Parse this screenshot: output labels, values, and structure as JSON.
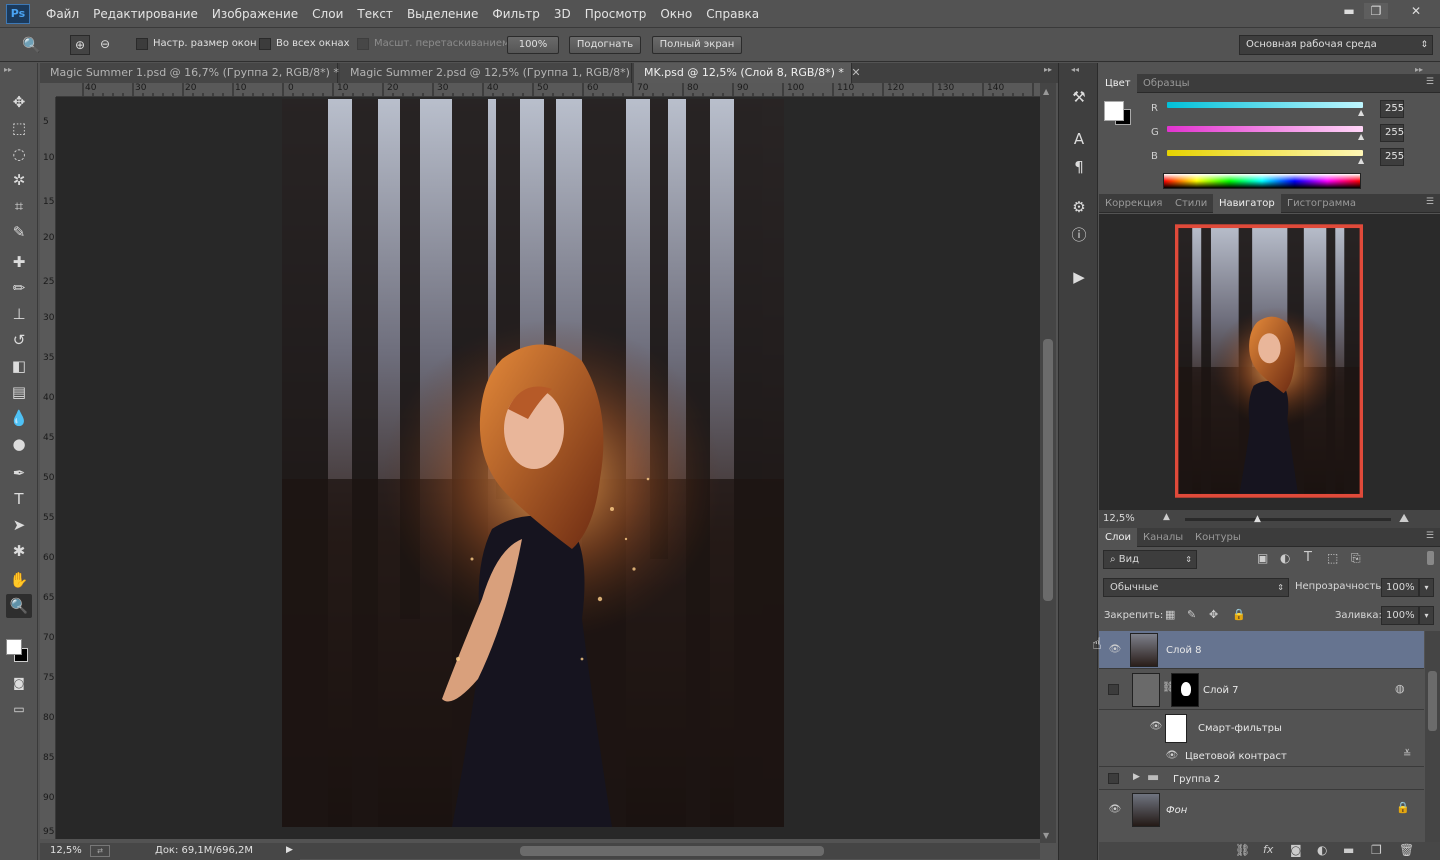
{
  "app": {
    "logo": "Ps"
  },
  "menu": [
    "Файл",
    "Редактирование",
    "Изображение",
    "Слои",
    "Текст",
    "Выделение",
    "Фильтр",
    "3D",
    "Просмотр",
    "Окно",
    "Справка"
  ],
  "window_controls": {
    "minimize": "▬",
    "restore": "❐",
    "close": "✕"
  },
  "options": {
    "resize_windows": "Настр. размер окон",
    "all_windows": "Во всех окнах",
    "scrubby_zoom": "Масшт. перетаскиванием",
    "zoom100": "100%",
    "fit": "Подогнать",
    "fill_screen": "Полный экран",
    "workspace": "Основная рабочая среда"
  },
  "doc_tabs": [
    {
      "label": "Magic Summer 1.psd @ 16,7% (Группа 2, RGB/8*) *",
      "active": false
    },
    {
      "label": "Magic Summer 2.psd @ 12,5% (Группа 1, RGB/8*)",
      "active": false
    },
    {
      "label": "MK.psd @ 12,5% (Слой 8, RGB/8*) *",
      "active": true
    }
  ],
  "ruler_h": [
    "40",
    "30",
    "20",
    "10",
    "0",
    "10",
    "20",
    "30",
    "40",
    "50",
    "60",
    "70",
    "80",
    "90",
    "100",
    "110",
    "120",
    "130",
    "140"
  ],
  "ruler_v": [
    "5",
    "10",
    "15",
    "20",
    "25",
    "30",
    "35",
    "40",
    "45",
    "50",
    "55",
    "60",
    "65",
    "70",
    "75",
    "80",
    "85",
    "90",
    "95"
  ],
  "status": {
    "zoom": "12,5%",
    "doc": "Док: 69,1M/696,2M"
  },
  "color_panel": {
    "tabs": [
      "Цвет",
      "Образцы"
    ],
    "channels": [
      {
        "label": "R",
        "value": "255",
        "color": "#35c7e0"
      },
      {
        "label": "G",
        "value": "255",
        "color": "#e13fd6"
      },
      {
        "label": "B",
        "value": "255",
        "color": "#e6d91f"
      }
    ]
  },
  "nav_panel": {
    "tabs": [
      "Коррекция",
      "Стили",
      "Навигатор",
      "Гистограмма"
    ],
    "zoom": "12,5%"
  },
  "layers_panel": {
    "tabs": [
      "Слои",
      "Каналы",
      "Контуры"
    ],
    "filter": "Вид",
    "blend_mode": "Обычные",
    "opacity_label": "Непрозрачность:",
    "opacity": "100%",
    "lock_label": "Закрепить:",
    "fill_label": "Заливка:",
    "fill": "100%",
    "layers": [
      {
        "name": "Слой 8",
        "selected": true,
        "visible": true
      },
      {
        "name": "Слой 7",
        "selected": false,
        "visible": false
      },
      {
        "name": "Смарт-фильтры",
        "selected": false,
        "visible": true
      },
      {
        "name": "Цветовой контраст",
        "selected": false,
        "visible": true
      },
      {
        "name": "Группа 2",
        "selected": false,
        "visible": false
      },
      {
        "name": "Фон",
        "selected": false,
        "visible": true
      }
    ]
  }
}
